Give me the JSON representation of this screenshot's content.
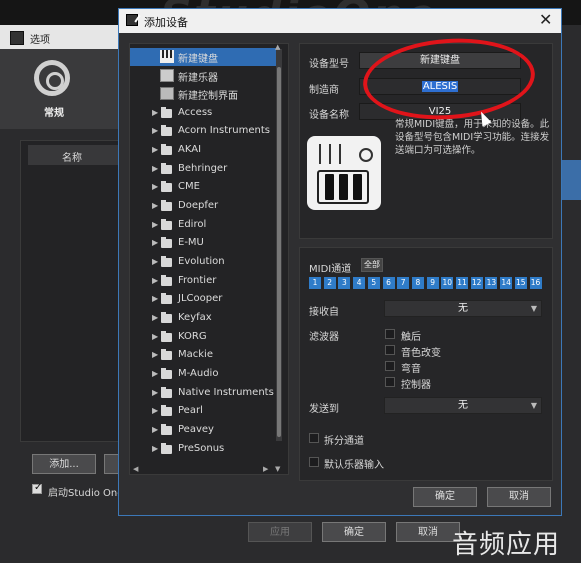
{
  "background": {
    "banner_text": "StudioOne",
    "window_title": "选项",
    "general_label": "常规",
    "name_column": "名称",
    "add_button": "添加...",
    "startup_label": "启动Studio One",
    "apply_button": "应用",
    "ok_button": "确定",
    "cancel_button": "取消",
    "watermark": "音频应用"
  },
  "dialog": {
    "title": "添加设备",
    "close_glyph": "✕",
    "tree": {
      "top_items": [
        {
          "label": "新建键盘",
          "icon": "keyboard-icon",
          "selected": true
        },
        {
          "label": "新建乐器",
          "icon": "instrument-icon",
          "selected": false
        },
        {
          "label": "新建控制界面",
          "icon": "control-surface-icon",
          "selected": false
        }
      ],
      "folders": [
        "Access",
        "Acorn Instruments",
        "AKAI",
        "Behringer",
        "CME",
        "Doepfer",
        "Edirol",
        "E-MU",
        "Evolution",
        "Frontier",
        "JLCooper",
        "Keyfax",
        "KORG",
        "Mackie",
        "M-Audio",
        "Native Instruments",
        "Pearl",
        "Peavey",
        "PreSonus"
      ]
    },
    "device": {
      "model_label": "设备型号",
      "model_value": "新建键盘",
      "manufacturer_label": "制造商",
      "manufacturer_value": "ALESIS",
      "name_label": "设备名称",
      "name_value": "VI25",
      "description": "常规MIDI键盘，用于未知的设备。此设备型号包含MIDI学习功能。连接发送端口为可选操作。"
    },
    "midi": {
      "channel_label": "MIDI通道",
      "all_button": "全部",
      "channels": [
        "1",
        "2",
        "3",
        "4",
        "5",
        "6",
        "7",
        "8",
        "9",
        "10",
        "11",
        "12",
        "13",
        "14",
        "15",
        "16"
      ],
      "receive_label": "接收自",
      "receive_value": "无",
      "filter_label": "滤波器",
      "filters": [
        "触后",
        "音色改变",
        "弯音",
        "控制器"
      ],
      "send_label": "发送到",
      "send_value": "无",
      "split_channels": "拆分通道",
      "default_instrument_input": "默认乐器输入"
    },
    "ok_button": "确定",
    "cancel_button": "取消"
  },
  "colors": {
    "accent": "#2f6cb3",
    "highlight": "#2e6fd1",
    "annotation_red": "#e0141a"
  }
}
